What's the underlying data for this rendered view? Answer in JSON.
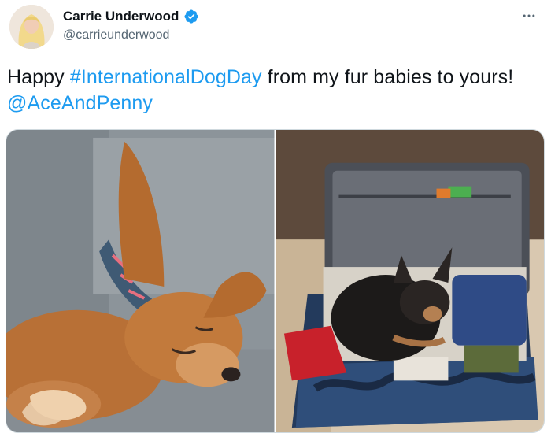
{
  "author": {
    "display_name": "Carrie Underwood",
    "handle": "@carrieunderwood",
    "verified": true,
    "avatar_icon": "profile-photo"
  },
  "menu": {
    "icon": "more-horizontal-icon"
  },
  "tweet": {
    "text_before": "Happy ",
    "hashtag": "#InternationalDogDay",
    "text_middle": " from my fur babies to yours! ",
    "mention": "@AceAndPenny"
  },
  "media": {
    "photos": [
      {
        "subject": "dog-sleeping-on-couch"
      },
      {
        "subject": "dog-in-suitcase"
      }
    ]
  },
  "colors": {
    "link": "#1d9bf0",
    "text": "#0f1419",
    "secondary": "#536471",
    "verified": "#1d9bf0"
  }
}
